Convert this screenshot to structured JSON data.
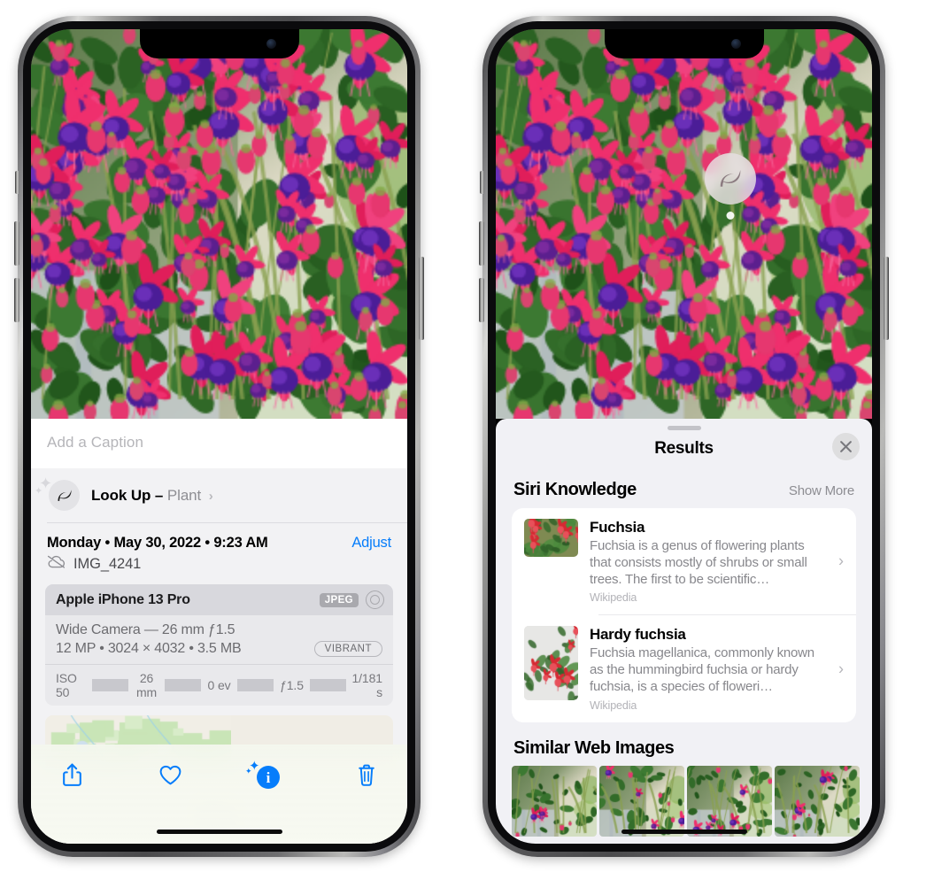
{
  "left_phone": {
    "name": "iPhone showing Photos info panel",
    "caption_placeholder": "Add a Caption",
    "lookup": {
      "label": "Look Up",
      "dash": "–",
      "value": "Plant",
      "icon": "leaf-icon",
      "chevron": "›"
    },
    "date_line": "Monday • May 30, 2022 • 9:23 AM",
    "adjust_label": "Adjust",
    "file_icon": "cloud-slash-icon",
    "file_name": "IMG_4241",
    "camera": {
      "device": "Apple iPhone 13 Pro",
      "format_badge": "JPEG",
      "lens_icon": "aperture-icon",
      "lens_line": "Wide Camera — 26 mm ƒ1.5",
      "spec_line": "12 MP • 3024 × 4032 • 3.5 MB",
      "style_badge": "VIBRANT",
      "exif": [
        "ISO 50",
        "26 mm",
        "0 ev",
        "ƒ1.5",
        "1/181 s"
      ]
    },
    "toolbar": [
      {
        "name": "share-button",
        "icon": "share-icon"
      },
      {
        "name": "favorite-button",
        "icon": "heart-icon"
      },
      {
        "name": "info-button",
        "icon": "info-sparkle-icon"
      },
      {
        "name": "delete-button",
        "icon": "trash-icon"
      }
    ]
  },
  "right_phone": {
    "name": "iPhone showing Visual Look Up results",
    "badge_icon": "leaf-icon",
    "sheet": {
      "title": "Results",
      "close_icon": "close-icon",
      "sections": [
        {
          "title": "Siri Knowledge",
          "action": "Show More",
          "items": [
            {
              "title": "Fuchsia",
              "description": "Fuchsia is a genus of flowering plants that consists mostly of shrubs or small trees. The first to be scientific…",
              "source": "Wikipedia",
              "chevron": "›"
            },
            {
              "title": "Hardy fuchsia",
              "description": "Fuchsia magellanica, commonly known as the hummingbird fuchsia or hardy fuchsia, is a species of floweri…",
              "source": "Wikipedia",
              "chevron": "›"
            }
          ]
        },
        {
          "title": "Similar Web Images",
          "action": "",
          "images": 4
        }
      ]
    }
  },
  "colors": {
    "accent_blue": "#067dfb",
    "sheet_bg": "#f1f1f5",
    "card_bg": "#ffffff",
    "secondary_text": "#8e8e93",
    "badge_gray": "#a9a9ae"
  }
}
